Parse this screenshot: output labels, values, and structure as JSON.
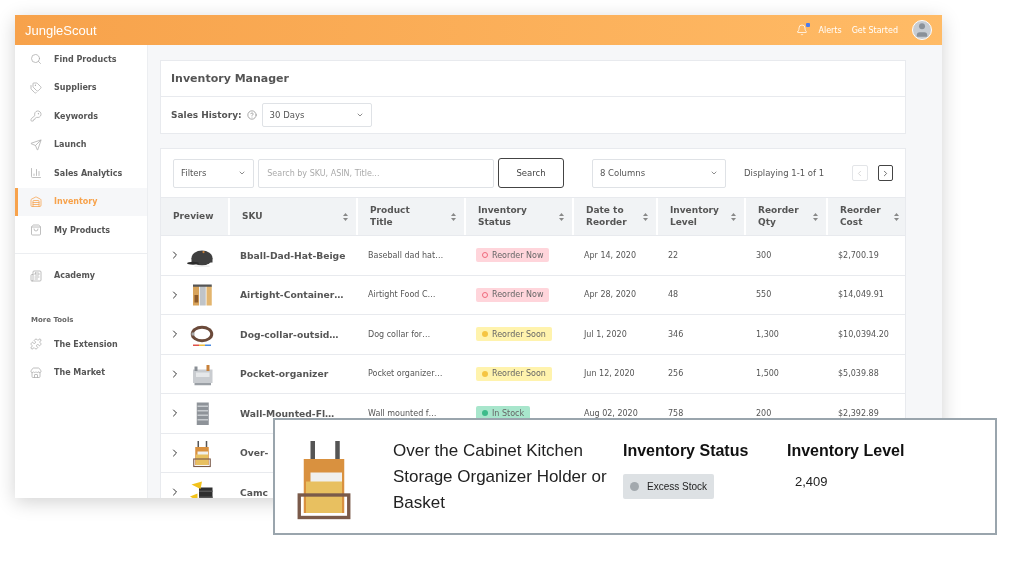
{
  "app": {
    "logo": "JungleScout",
    "alerts": "Alerts",
    "get_started": "Get Started",
    "alert_unread": true
  },
  "sidebar": {
    "sections": [
      {
        "items": [
          {
            "label": "Find Products",
            "selected": false
          },
          {
            "label": "Suppliers",
            "selected": false
          },
          {
            "label": "Keywords",
            "selected": false
          },
          {
            "label": "Launch",
            "selected": false
          },
          {
            "label": "Sales Analytics",
            "selected": false
          },
          {
            "label": "Inventory",
            "selected": true
          },
          {
            "label": "My Products",
            "selected": false
          }
        ]
      },
      {
        "items": [
          {
            "label": "Academy",
            "selected": false
          }
        ]
      },
      {
        "heading": "More Tools",
        "items": [
          {
            "label": "The Extension",
            "selected": false
          },
          {
            "label": "The Market",
            "selected": false
          }
        ]
      }
    ]
  },
  "page": {
    "title": "Inventory Manager",
    "sales_history": {
      "label": "Sales History:",
      "value": "30 Days"
    }
  },
  "toolbar": {
    "filters": "Filters",
    "search_placeholder": "Search by SKU, ASIN, Title...",
    "search_button": "Search",
    "columns": "8 Columns",
    "displaying": "Displaying 1-1 of 1",
    "pagination": [
      {
        "kind": "prev",
        "disabled": true
      },
      {
        "kind": "next",
        "disabled": false
      }
    ]
  },
  "table": {
    "columns": [
      {
        "label": "Preview",
        "sortable": false
      },
      {
        "label": "SKU",
        "sortable": true
      },
      {
        "label": "Product Title",
        "sortable": true
      },
      {
        "label": "Inventory Status",
        "sortable": true
      },
      {
        "label": "Date to Reorder",
        "sortable": true
      },
      {
        "label": "Inventory Level",
        "sortable": true
      },
      {
        "label": "Reorder Qty",
        "sortable": true
      },
      {
        "label": "Reorder Cost",
        "sortable": true
      }
    ],
    "rows": [
      {
        "sku": "Bball-Dad-Hat-Beige",
        "title": "Baseball dad hat…",
        "status": {
          "label": "Reorder Now",
          "kind": "reorder_now"
        },
        "date": "Apr 14, 2020",
        "inventory_level": "22",
        "qty": "300",
        "cost": "$2,700.19"
      },
      {
        "sku": "Airtight-Container…",
        "title": "Airtight Food C…",
        "status": {
          "label": "Reorder Now",
          "kind": "reorder_now"
        },
        "date": "Apr 28, 2020",
        "inventory_level": "48",
        "qty": "550",
        "cost": "$14,049.91"
      },
      {
        "sku": "Dog-collar-outsid…",
        "title": "Dog collar for…",
        "status": {
          "label": "Reorder Soon",
          "kind": "reorder_soon"
        },
        "date": "Jul 1, 2020",
        "inventory_level": "346",
        "qty": "1,300",
        "cost": "$10,0394.20"
      },
      {
        "sku": "Pocket-organizer",
        "title": "Pocket organizer…",
        "status": {
          "label": "Reorder Soon",
          "kind": "reorder_soon"
        },
        "date": "Jun 12, 2020",
        "inventory_level": "256",
        "qty": "1,500",
        "cost": "$5,039.88"
      },
      {
        "sku": "Wall-Mounted-Fl…",
        "title": "Wall mounted f…",
        "status": {
          "label": "In Stock",
          "kind": "in_stock"
        },
        "date": "Aug 02, 2020",
        "inventory_level": "758",
        "qty": "200",
        "cost": "$2,392.89"
      },
      {
        "sku": "Over-"
      },
      {
        "sku": "Camc"
      }
    ]
  },
  "detail_card": {
    "title": "Over the Cabinet Kitchen Storage Organizer Holder or Basket",
    "status_heading": "Inventory Status",
    "status": {
      "label": "Excess Stock",
      "kind": "excess_stock"
    },
    "level_heading": "Inventory Level",
    "inventory_level": "2,409"
  }
}
